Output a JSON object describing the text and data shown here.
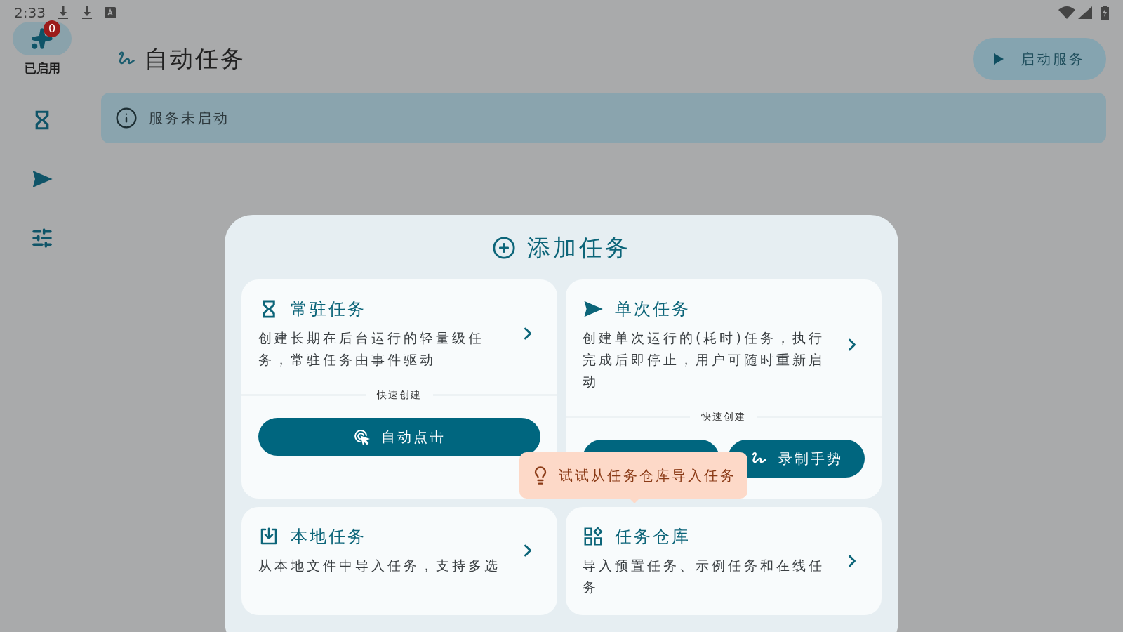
{
  "status_bar": {
    "time": "2:33"
  },
  "nav_rail": {
    "badge": "0",
    "items": [
      {
        "kind": "sparkle",
        "label": "已启用",
        "selected": true
      },
      {
        "kind": "hourglass",
        "selected": false
      },
      {
        "kind": "send",
        "selected": false
      },
      {
        "kind": "tune",
        "selected": false
      }
    ]
  },
  "header": {
    "title": "自动任务",
    "action": "启动服务"
  },
  "notice": "服务未启动",
  "dialog": {
    "title": "添加任务",
    "tooltip": "试试从任务仓库导入任务",
    "cards": [
      {
        "kind": "hourglass",
        "title": "常驻任务",
        "description": "创建长期在后台运行的轻量级任务，常驻任务由事件驱动",
        "quick_create_label": "快速创建",
        "quick_buttons": [
          {
            "kind": "tap",
            "label": "自动点击"
          }
        ]
      },
      {
        "kind": "send",
        "title": "单次任务",
        "description": "创建单次运行的(耗时)任务，执行完成后即停止，用户可随时重新启动",
        "quick_create_label": "快速创建",
        "quick_buttons": [
          {
            "kind": "tap"
          },
          {
            "kind": "gesture",
            "label": "录制手势"
          }
        ]
      },
      {
        "kind": "import",
        "title": "本地任务",
        "description": "从本地文件中导入任务，支持多选"
      },
      {
        "kind": "grid",
        "title": "任务仓库",
        "description": "导入预置任务、示例任务和在线任务"
      }
    ]
  }
}
